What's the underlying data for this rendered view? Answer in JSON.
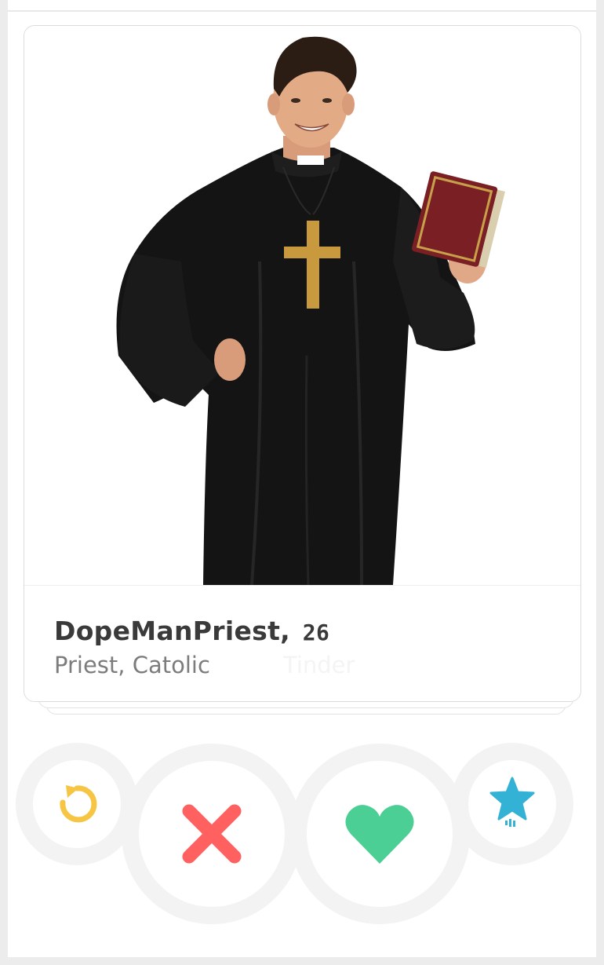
{
  "profile": {
    "name": "DopeManPriest,",
    "age": "26",
    "job": "Priest, Catolic",
    "ghost_text": "Tinder"
  },
  "actions": {
    "undo_icon": "undo-arrow-icon",
    "nope_icon": "x-icon",
    "like_icon": "heart-icon",
    "superlike_icon": "star-icon"
  },
  "colors": {
    "undo": "#f7c544",
    "nope": "#ff6161",
    "like": "#4ccf94",
    "superlike": "#33b2d6",
    "name_text": "#3a3a3a",
    "job_text": "#7c7c7c"
  }
}
